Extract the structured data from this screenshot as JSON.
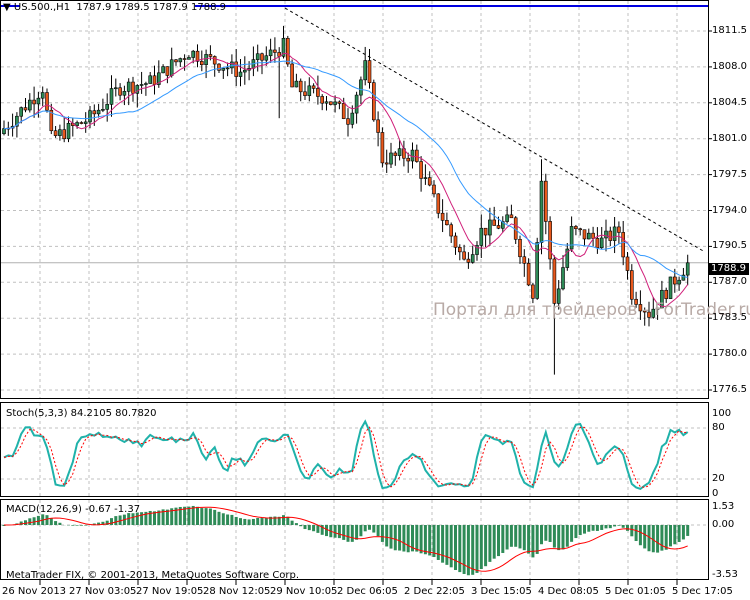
{
  "header": {
    "symbol": "US.500.,H1",
    "open": "1787.9",
    "high": "1789.5",
    "low": "1787.9",
    "close": "1788.9"
  },
  "price_axis": [
    "1811.5",
    "1808.0",
    "1804.5",
    "1801.0",
    "1797.5",
    "1794.0",
    "1790.5",
    "1787.0",
    "1783.5",
    "1780.0",
    "1776.5"
  ],
  "current_price": "1788.9",
  "watermark": "Портал для трейдеров - ForTrader.ru",
  "stoch": {
    "label": "Stoch(5,3,3) 84.2105 80.7820",
    "axis": [
      "100",
      "80",
      "20",
      "0"
    ]
  },
  "macd": {
    "label": "MACD(12,26,9) -0.67 -1.37",
    "axis": [
      "1.53",
      "0.00",
      "-3.53"
    ]
  },
  "copyright": "MetaTrader FIX, © 2001-2013, MetaQuotes Software Corp.",
  "time_axis": [
    "26 Nov 2013",
    "27 Nov 03:05",
    "27 Nov 19:05",
    "28 Nov 12:05",
    "29 Nov 10:05",
    "2 Dec 06:05",
    "2 Dec 22:05",
    "3 Dec 15:05",
    "4 Dec 08:05",
    "5 Dec 01:05",
    "5 Dec 17:05"
  ],
  "colors": {
    "bull": "#2e8b57",
    "bear": "#e8581c",
    "ma_fast": "#d0207a",
    "ma_slow": "#3399ff",
    "stoch_main": "#20b2aa",
    "stoch_signal": "#ff0000",
    "macd_hist": "#2e8b57",
    "macd_signal": "#ff0000"
  },
  "chart_data": {
    "type": "candlestick",
    "keypoints": [
      [
        0,
        1802
      ],
      [
        9,
        1806
      ],
      [
        11,
        1801
      ],
      [
        20,
        1803
      ],
      [
        27,
        1806
      ],
      [
        34,
        1806.5
      ],
      [
        43,
        1809.5
      ],
      [
        55,
        1807.5
      ],
      [
        65,
        1810
      ],
      [
        67,
        1806
      ],
      [
        75,
        1805
      ],
      [
        80,
        1803
      ],
      [
        84,
        1808
      ],
      [
        88,
        1799
      ],
      [
        95,
        1799.5
      ],
      [
        100,
        1795
      ],
      [
        107,
        1789
      ],
      [
        111,
        1792
      ],
      [
        118,
        1793
      ],
      [
        123,
        1786
      ],
      [
        125,
        1797
      ],
      [
        128,
        1785
      ],
      [
        132,
        1792
      ],
      [
        139,
        1791
      ],
      [
        143,
        1792
      ],
      [
        146,
        1786
      ],
      [
        150,
        1784
      ],
      [
        159,
        1788.9
      ]
    ],
    "ylim": [
      1776.5,
      1811.5
    ]
  }
}
